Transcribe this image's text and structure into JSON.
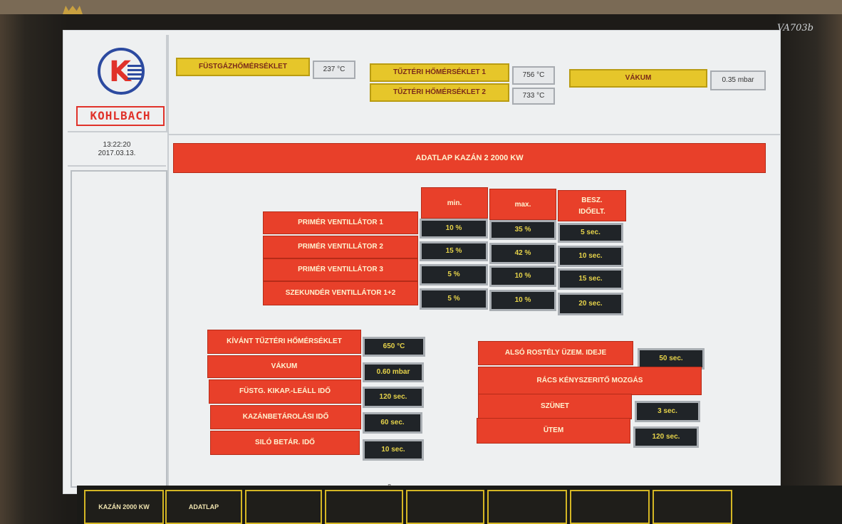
{
  "monitor": {
    "brand": "VA703b"
  },
  "logo": {
    "name": "KOHLBACH",
    "letter": "K"
  },
  "clock": {
    "time": "13:22:20",
    "date": "2017.03.13."
  },
  "readings": [
    {
      "label": "FÜSTGÁZHŐMÉRSÉKLET",
      "value": "237 °C"
    },
    {
      "label": "TŰZTÉRI HŐMÉRSÉKLET 1",
      "value": "756 °C"
    },
    {
      "label": "TŰZTÉRI HŐMÉRSÉKLET 2",
      "value": "733 °C"
    },
    {
      "label": "VÁKUM",
      "value": "0.35 mbar"
    }
  ],
  "title": "ADATLAP KAZÁN 2 2000 KW",
  "fan_table": {
    "headers": [
      "min.",
      "max.",
      "BESZ. IDŐELT."
    ],
    "rows": [
      {
        "label": "PRIMÉR VENTILLÁTOR 1",
        "min": "10 %",
        "max": "35 %",
        "time": "5 sec."
      },
      {
        "label": "PRIMÉR VENTILLÁTOR 2",
        "min": "15 %",
        "max": "42 %",
        "time": "10 sec."
      },
      {
        "label": "PRIMÉR VENTILLÁTOR 3",
        "min": "5 %",
        "max": "10 %",
        "time": "15 sec."
      },
      {
        "label": "SZEKUNDÉR VENTILLÁTOR 1+2",
        "min": "5 %",
        "max": "10 %",
        "time": "20 sec."
      }
    ]
  },
  "left_params": [
    {
      "label": "KÍVÁNT TŰZTÉRI HŐMÉRSÉKLET",
      "value": "650 °C"
    },
    {
      "label": "VÁKUM",
      "value": "0.60 mbar"
    },
    {
      "label": "FÜSTG. KIKAP.-LEÁLL IDŐ",
      "value": "120 sec."
    },
    {
      "label": "KAZÁNBETÁROLÁSI IDŐ",
      "value": "60 sec."
    },
    {
      "label": "SILÓ BETÁR. IDŐ",
      "value": "10 sec."
    }
  ],
  "right_params": {
    "grate_time": {
      "label": "ALSÓ ROSTÉLY ÜZEM. IDEJE",
      "value": "50 sec."
    },
    "forced_label": "RÁCS KÉNYSZERITŐ MOZGÁS",
    "pause": {
      "label": "SZÜNET",
      "value": "3 sec."
    },
    "cycle": {
      "label": "ÜTEM",
      "value": "120 sec."
    }
  },
  "footer": {
    "buttons": [
      "KAZÁN 2000 KW",
      "ADATLAP",
      "",
      "",
      "",
      "",
      "",
      ""
    ]
  }
}
